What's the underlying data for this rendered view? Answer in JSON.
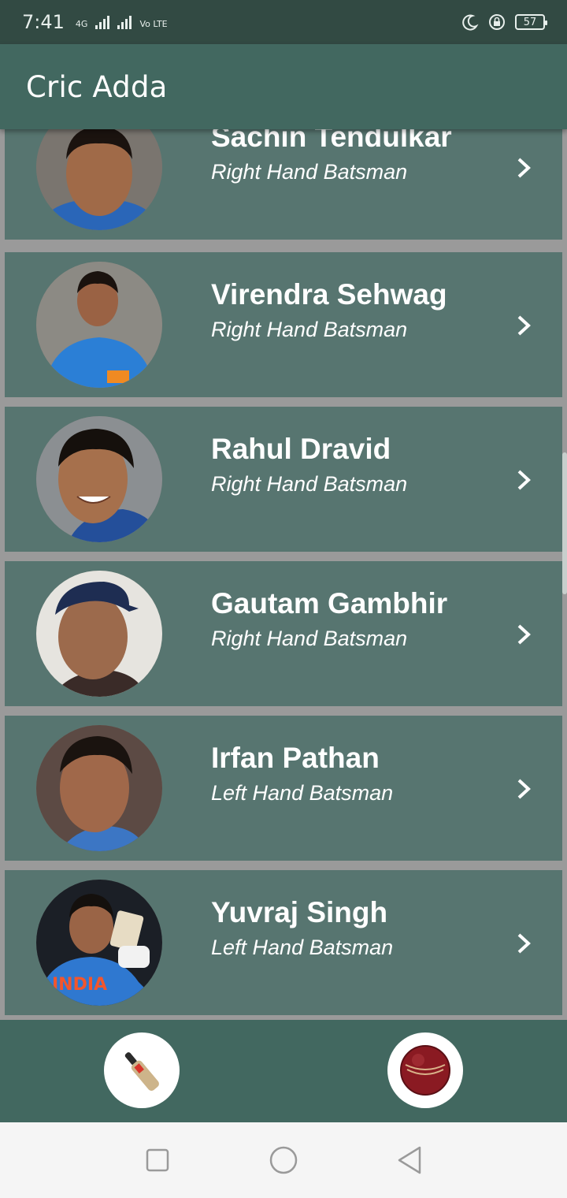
{
  "status_bar": {
    "time": "7:41",
    "network_4g": "4G",
    "volte": "Vo LTE",
    "battery": "57",
    "icons": [
      "moon-icon",
      "lock-rotation-icon",
      "battery-icon"
    ]
  },
  "app_bar": {
    "title": "Cric Adda"
  },
  "players": [
    {
      "name": "Sachin Tendulkar",
      "role": "Right Hand Batsman"
    },
    {
      "name": "Virendra Sehwag",
      "role": "Right Hand Batsman"
    },
    {
      "name": "Rahul Dravid",
      "role": "Right Hand Batsman"
    },
    {
      "name": "Gautam Gambhir",
      "role": "Right Hand Batsman"
    },
    {
      "name": "Irfan Pathan",
      "role": "Left Hand Batsman"
    },
    {
      "name": "Yuvraj Singh",
      "role": "Left Hand Batsman"
    }
  ],
  "bottom_bar": {
    "buttons": [
      "bat-icon",
      "ball-icon"
    ]
  },
  "nav_bar": {
    "buttons": [
      "recents-icon",
      "home-icon",
      "back-icon"
    ]
  },
  "colors": {
    "status_bar": "#324a43",
    "app_bar": "#426860",
    "card": "#577570",
    "list_bg": "#9a9a9a",
    "nav_bar": "#f5f5f5"
  }
}
